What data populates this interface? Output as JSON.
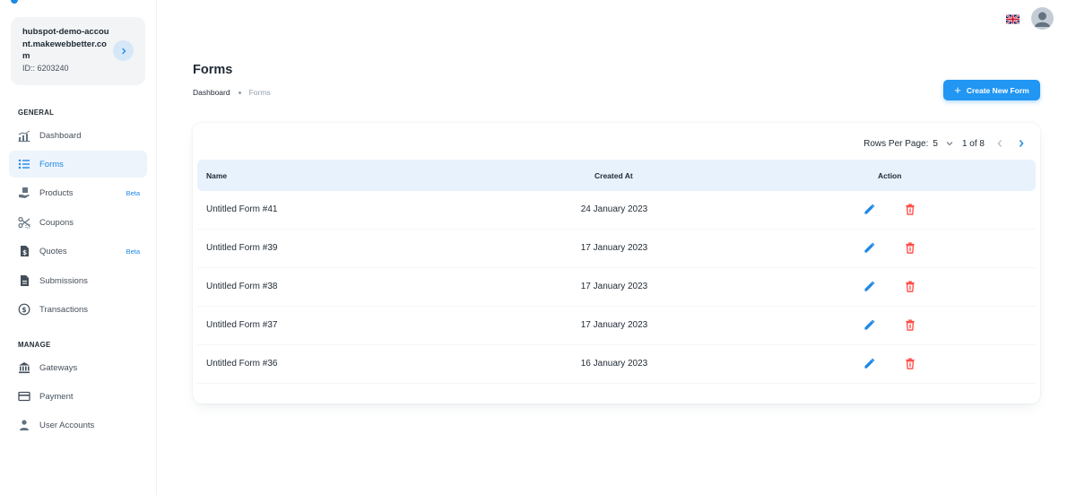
{
  "account": {
    "name": "hubspot-demo-account.makewebbetter.com",
    "id_label": "ID:: 6203240"
  },
  "sidebar": {
    "general_label": "GENERAL",
    "manage_label": "MANAGE",
    "items": [
      {
        "label": "Dashboard",
        "icon": "chart-icon"
      },
      {
        "label": "Forms",
        "icon": "list-icon",
        "active": true
      },
      {
        "label": "Products",
        "icon": "hand-box-icon",
        "badge": "Beta"
      },
      {
        "label": "Coupons",
        "icon": "scissors-icon"
      },
      {
        "label": "Quotes",
        "icon": "dollar-doc-icon",
        "badge": "Beta"
      },
      {
        "label": "Submissions",
        "icon": "document-icon"
      },
      {
        "label": "Transactions",
        "icon": "currency-exchange-icon"
      }
    ],
    "manage_items": [
      {
        "label": "Gateways",
        "icon": "bank-icon"
      },
      {
        "label": "Payment",
        "icon": "credit-card-icon"
      },
      {
        "label": "User Accounts",
        "icon": "person-icon"
      }
    ]
  },
  "header": {
    "language": "uk-flag-icon",
    "avatar": "user-avatar-icon"
  },
  "page": {
    "title": "Forms",
    "breadcrumb": [
      "Dashboard",
      "Forms"
    ],
    "create_button": "Create New Form"
  },
  "table": {
    "rows_per_page_label": "Rows Per Page:",
    "rows_per_page_value": "5",
    "page_info": "1 of 8",
    "columns": [
      "Name",
      "Created At",
      "Action"
    ],
    "rows": [
      {
        "name": "Untitled Form #41",
        "created_at": "24 January 2023"
      },
      {
        "name": "Untitled Form #39",
        "created_at": "17 January 2023"
      },
      {
        "name": "Untitled Form #38",
        "created_at": "17 January 2023"
      },
      {
        "name": "Untitled Form #37",
        "created_at": "17 January 2023"
      },
      {
        "name": "Untitled Form #36",
        "created_at": "16 January 2023"
      }
    ]
  },
  "colors": {
    "accent": "#2196f3",
    "delete": "#ff4842",
    "active_nav_bg": "#edf4fc"
  }
}
